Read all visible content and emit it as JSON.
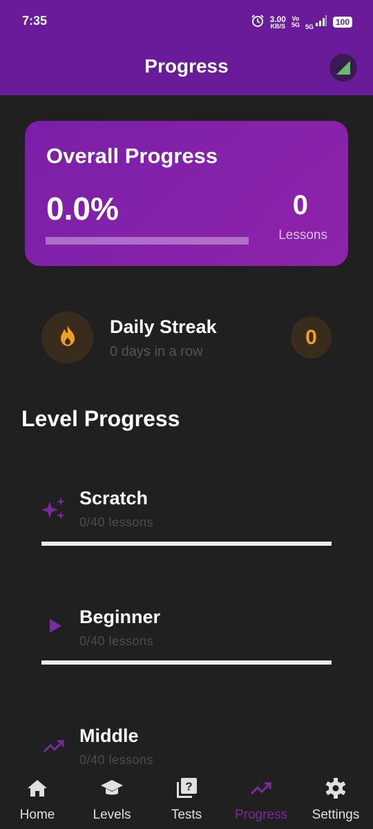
{
  "status": {
    "time": "7:35",
    "speed_value": "3.00",
    "speed_unit": "KB/S",
    "volte_top": "Vo",
    "volte_bottom": "5G",
    "net": "5G",
    "battery": "100"
  },
  "header": {
    "title": "Progress"
  },
  "overall": {
    "title": "Overall Progress",
    "percent": "0.0%",
    "progress_fraction": 0.0,
    "lessons_count": "0",
    "lessons_label": "Lessons"
  },
  "streak": {
    "title": "Daily Streak",
    "subtitle": "0 days in a row",
    "count": "0",
    "icon": "fire-icon"
  },
  "level_section": {
    "title": "Level Progress"
  },
  "levels": [
    {
      "name": "Scratch",
      "subtitle": "0/40 lessons",
      "icon": "sparkles-icon",
      "progress_fraction": 0.0
    },
    {
      "name": "Beginner",
      "subtitle": "0/40 lessons",
      "icon": "play-icon",
      "progress_fraction": 0.0
    },
    {
      "name": "Middle",
      "subtitle": "0/40 lessons",
      "icon": "trending-up-icon",
      "progress_fraction": 0.0
    }
  ],
  "nav": [
    {
      "label": "Home",
      "icon": "home-icon",
      "active": false
    },
    {
      "label": "Levels",
      "icon": "school-icon",
      "active": false
    },
    {
      "label": "Tests",
      "icon": "quiz-icon",
      "active": false
    },
    {
      "label": "Progress",
      "icon": "trending-up-icon",
      "active": true
    },
    {
      "label": "Settings",
      "icon": "gear-icon",
      "active": false
    }
  ],
  "colors": {
    "primary": "#6a1b9a",
    "accent": "#8e24aa",
    "streak": "#f0a020",
    "background": "#202020"
  }
}
